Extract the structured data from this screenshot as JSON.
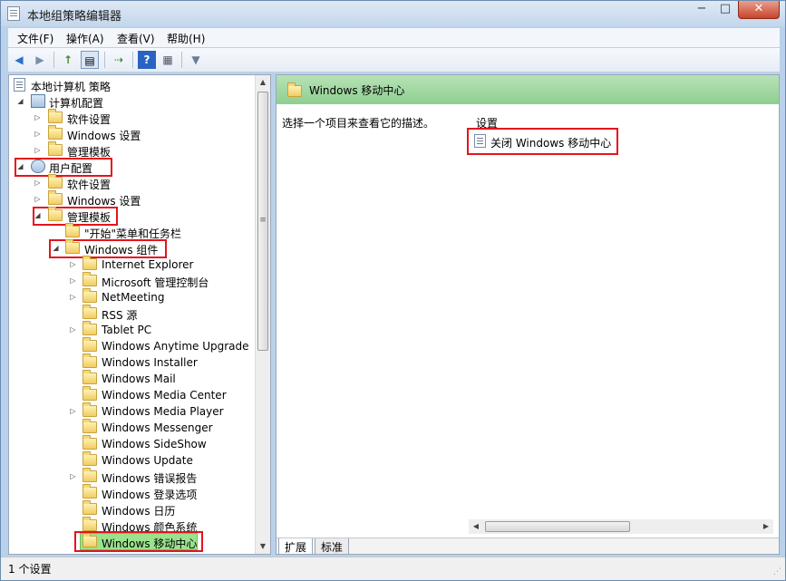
{
  "window": {
    "title": "本地组策略编辑器",
    "minimize": "−",
    "maximize": "□",
    "close": "✕"
  },
  "menu": [
    "文件(F)",
    "操作(A)",
    "查看(V)",
    "帮助(H)"
  ],
  "toolbar": {
    "back": "◀",
    "forward": "▶",
    "up": "↑",
    "show_tree": "▤",
    "export": "⇢",
    "help": "?",
    "properties": "▦",
    "filter": "▼"
  },
  "tree": {
    "root": "本地计算机 策略",
    "computer_config": "计算机配置",
    "computer_software": "软件设置",
    "computer_windows": "Windows 设置",
    "computer_admin": "管理模板",
    "user_config": "用户配置",
    "user_software": "软件设置",
    "user_windows": "Windows 设置",
    "user_admin": "管理模板",
    "start_menu": "\"开始\"菜单和任务栏",
    "windows_components": "Windows 组件",
    "components": [
      "Internet Explorer",
      "Microsoft 管理控制台",
      "NetMeeting",
      "RSS 源",
      "Tablet PC",
      "Windows Anytime Upgrade",
      "Windows Installer",
      "Windows Mail",
      "Windows Media Center",
      "Windows Media Player",
      "Windows Messenger",
      "Windows SideShow",
      "Windows Update",
      "Windows 错误报告",
      "Windows 登录选项",
      "Windows 日历",
      "Windows 颜色系统",
      "Windows 移动中心"
    ],
    "expand_closed": "▷",
    "expand_open": "◢"
  },
  "right": {
    "header": "Windows 移动中心",
    "description": "选择一个项目来查看它的描述。",
    "column_header": "设置",
    "items": [
      "关闭 Windows 移动中心"
    ]
  },
  "tabs": [
    "扩展",
    "标准"
  ],
  "status": "1 个设置",
  "colors": {
    "highlight_red": "#e3141d",
    "selected_green": "#9ae28d",
    "header_green": "#8fcf91"
  }
}
